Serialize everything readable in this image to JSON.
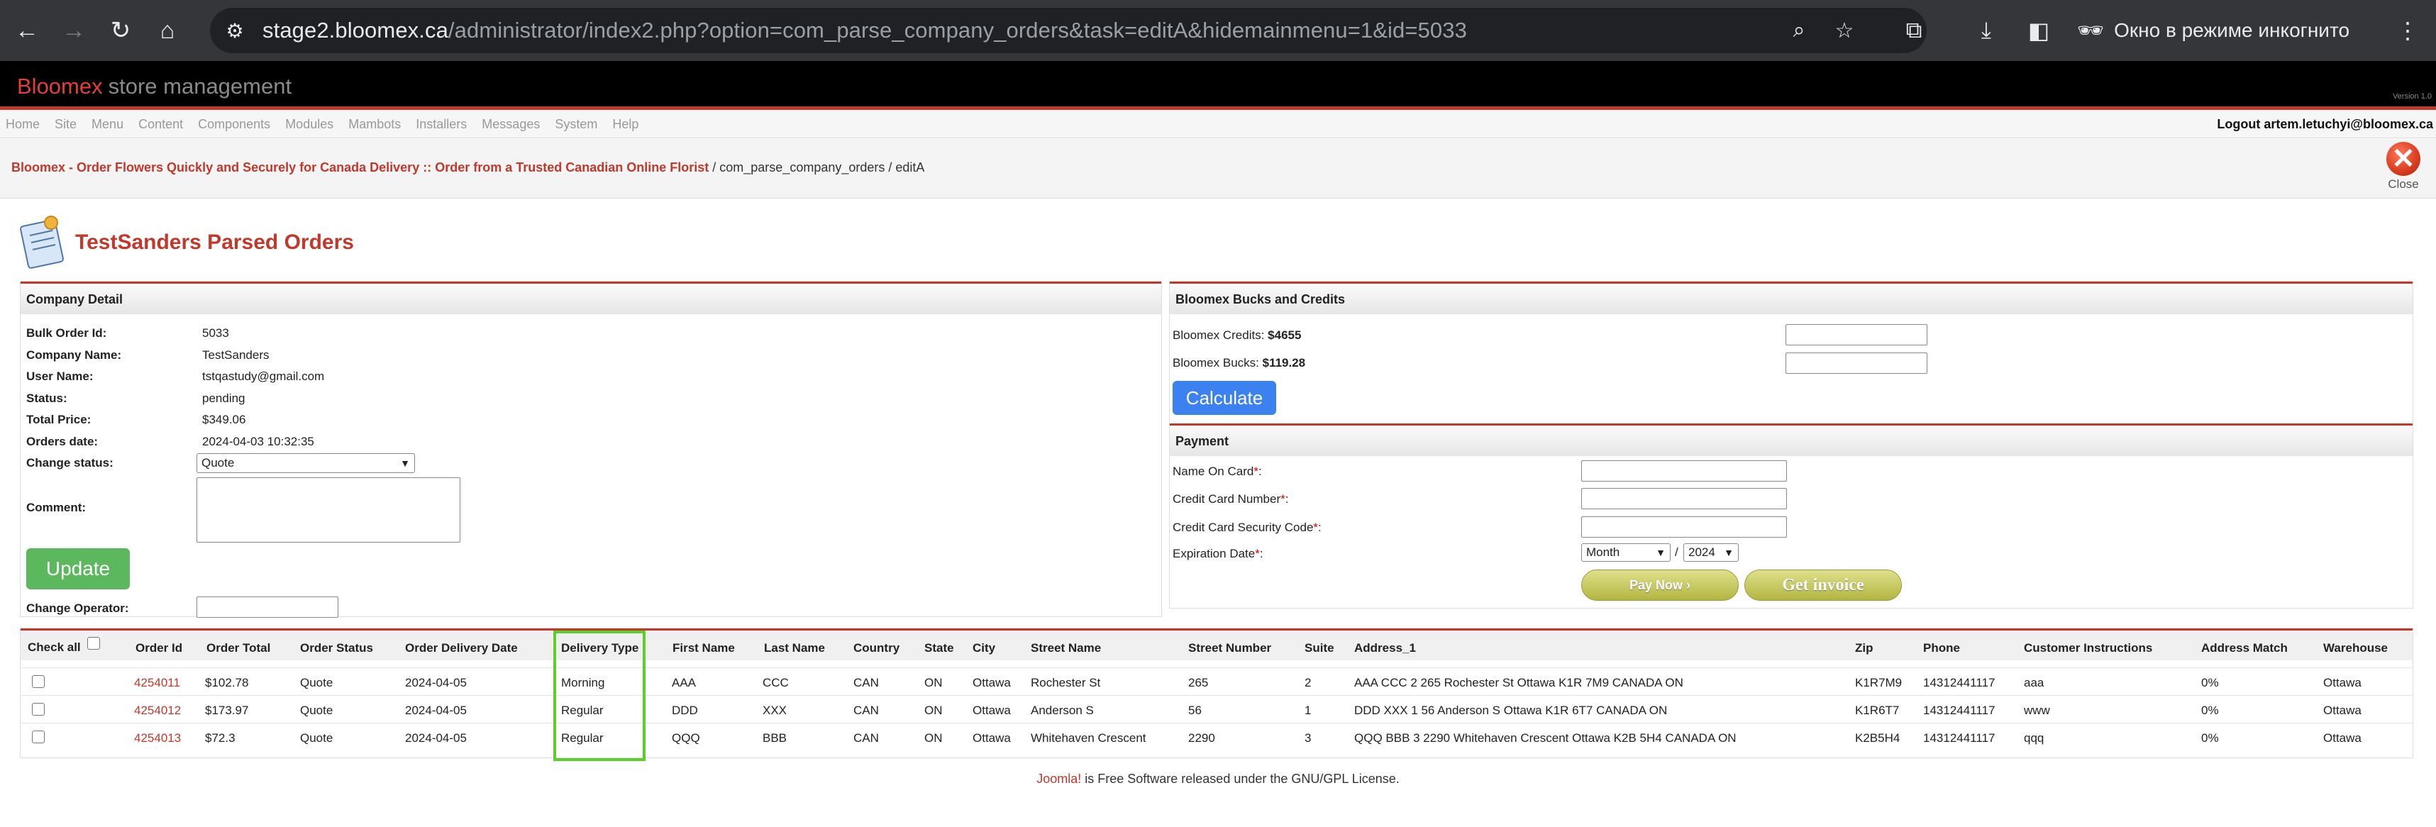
{
  "browser": {
    "url_host": "stage2.bloomex.ca",
    "url_path": "/administrator/index2.php?option=com_parse_company_orders&task=editA&hidemainmenu=1&id=5033",
    "incognito_label": "Окно в режиме инкогнито"
  },
  "header": {
    "brand_name": "Bloomex",
    "brand_sub": "store management",
    "version": "Version 1.0"
  },
  "menu": {
    "items": [
      "Home",
      "Site",
      "Menu",
      "Content",
      "Components",
      "Modules",
      "Mambots",
      "Installers",
      "Messages",
      "System",
      "Help"
    ],
    "logout": "Logout artem.letuchyi@bloomex.ca"
  },
  "breadcrumb": {
    "site_link": "Bloomex - Order Flowers Quickly and Securely for Canada Delivery :: Order from a Trusted Canadian Online Florist",
    "path": " / com_parse_company_orders / editA"
  },
  "toolbar": {
    "close_label": "Close"
  },
  "page": {
    "title": "TestSanders Parsed Orders"
  },
  "company": {
    "heading": "Company Detail",
    "bulk_order_label": "Bulk Order Id:",
    "bulk_order_value": "5033",
    "company_label": "Company Name:",
    "company_value": "TestSanders",
    "user_label": "User Name:",
    "user_value": "tstqastudy@gmail.com",
    "status_label": "Status:",
    "status_value": "pending",
    "total_label": "Total Price:",
    "total_value": "$349.06",
    "date_label": "Orders date:",
    "date_value": "2024-04-03 10:32:35",
    "change_status_label": "Change status:",
    "change_status_value": "Quote",
    "comment_label": "Comment:",
    "update_button": "Update",
    "change_operator_label": "Change Operator:"
  },
  "bucks": {
    "heading": "Bloomex Bucks and Credits",
    "credits_label": "Bloomex Credits: ",
    "credits_value": "$4655",
    "bucks_label": "Bloomex Bucks: ",
    "bucks_value": "$119.28",
    "calculate_button": "Calculate"
  },
  "payment": {
    "heading": "Payment",
    "name_label": "Name On Card",
    "cc_number_label": "Credit Card Number",
    "cc_code_label": "Credit Card Security Code",
    "expiry_label": "Expiration Date",
    "required_mark": "*",
    "colon": ":",
    "month_value": "Month",
    "year_value": "2024",
    "separator": "/",
    "pay_now_button": "Pay Now ›",
    "get_invoice_button": "Get invoice"
  },
  "orders": {
    "check_all_label": "Check all",
    "columns": [
      "Order Id",
      "Order Total",
      "Order Status",
      "Order Delivery Date",
      "Delivery Type",
      "First Name",
      "Last Name",
      "Country",
      "State",
      "City",
      "Street Name",
      "Street Number",
      "Suite",
      "Address_1",
      "Zip",
      "Phone",
      "Customer Instructions",
      "Address Match",
      "Warehouse"
    ],
    "rows": [
      [
        "4254011",
        "$102.78",
        "Quote",
        "2024-04-05",
        "Morning",
        "AAA",
        "CCC",
        "CAN",
        "ON",
        "Ottawa",
        "Rochester St",
        "265",
        "2",
        "AAA CCC 2 265 Rochester St Ottawa K1R 7M9 CANADA ON",
        "K1R7M9",
        "14312441117",
        "aaa",
        "0%",
        "Ottawa"
      ],
      [
        "4254012",
        "$173.97",
        "Quote",
        "2024-04-05",
        "Regular",
        "DDD",
        "XXX",
        "CAN",
        "ON",
        "Ottawa",
        "Anderson S",
        "56",
        "1",
        "DDD XXX 1 56 Anderson S Ottawa K1R 6T7 CANADA ON",
        "K1R6T7",
        "14312441117",
        "www",
        "0%",
        "Ottawa"
      ],
      [
        "4254013",
        "$72.3",
        "Quote",
        "2024-04-05",
        "Regular",
        "QQQ",
        "BBB",
        "CAN",
        "ON",
        "Ottawa",
        "Whitehaven Crescent",
        "2290",
        "3",
        "QQQ BBB 3 2290 Whitehaven Crescent Ottawa K2B 5H4 CANADA ON",
        "K2B5H4",
        "14312441117",
        "qqq",
        "0%",
        "Ottawa"
      ]
    ]
  },
  "footer": {
    "joomla": "Joomla!",
    "text": " is Free Software released under the GNU/GPL License."
  },
  "colors": {
    "accent_red": "#c0392b",
    "highlight_green": "#5bd02c",
    "update_green": "#5cb85c",
    "calc_blue": "#3b82f0"
  }
}
